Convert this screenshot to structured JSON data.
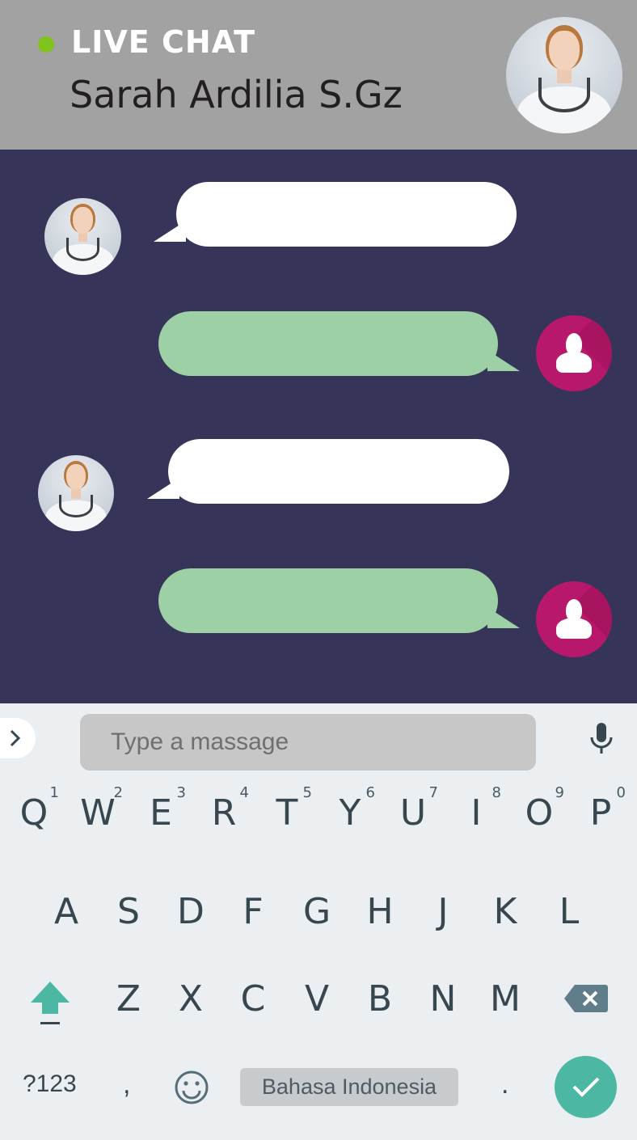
{
  "header": {
    "status_label": "LIVE CHAT",
    "contact_name": "Sarah Ardilia S.Gz",
    "status_color": "#7fc31c",
    "background_color": "#a2a2a2"
  },
  "chat": {
    "background_color": "#363559",
    "incoming_bubble_color": "#ffffff",
    "outgoing_bubble_color": "#9dd0a5",
    "user_avatar_color": "#b8186b",
    "messages": [
      {
        "sender": "doctor",
        "text": ""
      },
      {
        "sender": "user",
        "text": ""
      },
      {
        "sender": "doctor",
        "text": ""
      },
      {
        "sender": "user",
        "text": ""
      }
    ]
  },
  "input": {
    "placeholder": "Type a massage",
    "expand_icon": "chevron-right-icon",
    "mic_icon": "microphone-icon"
  },
  "keyboard": {
    "row1": [
      {
        "ch": "Q",
        "alt": "1"
      },
      {
        "ch": "W",
        "alt": "2"
      },
      {
        "ch": "E",
        "alt": "3"
      },
      {
        "ch": "R",
        "alt": "4"
      },
      {
        "ch": "T",
        "alt": "5"
      },
      {
        "ch": "Y",
        "alt": "6"
      },
      {
        "ch": "U",
        "alt": "7"
      },
      {
        "ch": "I",
        "alt": "8"
      },
      {
        "ch": "O",
        "alt": "9"
      },
      {
        "ch": "P",
        "alt": "0"
      }
    ],
    "row2": [
      "A",
      "S",
      "D",
      "F",
      "G",
      "H",
      "J",
      "K",
      "L"
    ],
    "row3": [
      "Z",
      "X",
      "C",
      "V",
      "B",
      "N",
      "M"
    ],
    "mode_label": "?123",
    "comma": ",",
    "space_label": "Bahasa Indonesia",
    "period": ".",
    "accent_color": "#4cb8a3"
  }
}
